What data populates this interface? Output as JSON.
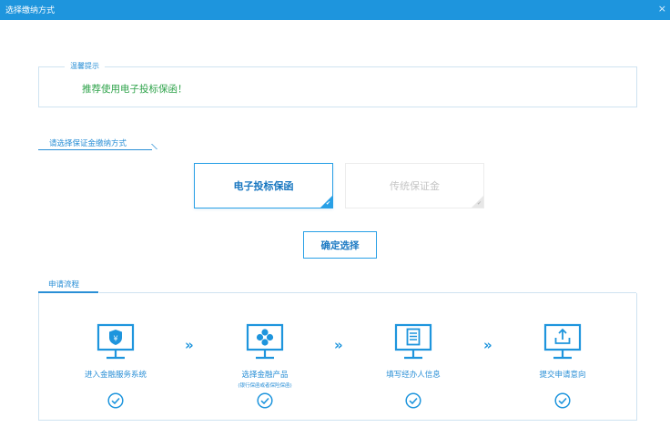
{
  "window": {
    "title": "选择缴纳方式",
    "close_glyph": "×"
  },
  "tips": {
    "legend": "温馨提示",
    "message": "推荐使用电子投标保函！"
  },
  "choose_section": {
    "title": "请选择保证金缴纳方式"
  },
  "options": [
    {
      "label": "电子投标保函",
      "selected": true
    },
    {
      "label": "传统保证金",
      "selected": false
    }
  ],
  "confirm_button": {
    "label": "确定选择"
  },
  "process_section": {
    "title": "申请流程"
  },
  "steps": [
    {
      "label": "进入金融服务系统",
      "sublabel": "",
      "icon": "bank-monitor-icon"
    },
    {
      "label": "选择金融产品",
      "sublabel": "(银行保函或者保险保函)",
      "icon": "product-monitor-icon"
    },
    {
      "label": "填写经办人信息",
      "sublabel": "",
      "icon": "form-monitor-icon"
    },
    {
      "label": "提交申请意向",
      "sublabel": "",
      "icon": "upload-monitor-icon"
    }
  ],
  "step_separator": "»",
  "colors": {
    "accent": "#1e95dd",
    "tip_text": "#2ea34a",
    "inactive_text": "#c5c5c5"
  }
}
